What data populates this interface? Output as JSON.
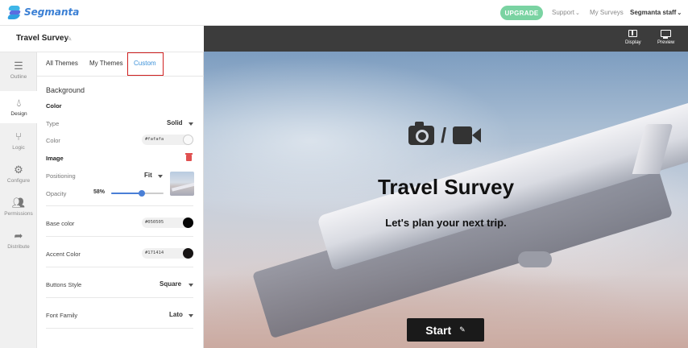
{
  "app": {
    "brand": "Segmanta",
    "upgrade_label": "UPGRADE",
    "nav": {
      "support": "Support",
      "my_surveys": "My Surveys",
      "account": "Segmanta staff"
    }
  },
  "survey": {
    "title": "Travel Survey"
  },
  "rail": [
    {
      "label": "Outline",
      "icon": "list-icon"
    },
    {
      "label": "Design",
      "icon": "drop-icon",
      "active": true
    },
    {
      "label": "Logic",
      "icon": "branch-icon"
    },
    {
      "label": "Configure",
      "icon": "gear-icon"
    },
    {
      "label": "Permissions",
      "icon": "users-icon"
    },
    {
      "label": "Distribute",
      "icon": "share-icon"
    }
  ],
  "tabs": {
    "all": "All Themes",
    "mine": "My Themes",
    "custom": "Custom"
  },
  "design": {
    "background_heading": "Background",
    "color_heading": "Color",
    "type_label": "Type",
    "type_value": "Solid",
    "color_label": "Color",
    "color_value": "#fafafa",
    "image_heading": "Image",
    "positioning_label": "Positioning",
    "positioning_value": "Fit",
    "opacity_label": "Opacity",
    "opacity_value": "58%",
    "opacity_fraction": 0.58,
    "base_color_label": "Base color",
    "base_color_value": "#050505",
    "accent_color_label": "Accent Color",
    "accent_color_value": "#171414",
    "buttons_style_label": "Buttons Style",
    "buttons_style_value": "Square",
    "font_family_label": "Font Family",
    "font_family_value": "Lato"
  },
  "preview_toolbar": {
    "display": "Display",
    "preview": "Preview"
  },
  "preview": {
    "title": "Travel Survey",
    "subtitle": "Let's plan your next trip.",
    "start": "Start"
  },
  "colors": {
    "accent_tab": "#3a90d8",
    "upgrade": "#7ad3a2",
    "slider": "#4a7fd6",
    "delete": "#e05050"
  }
}
